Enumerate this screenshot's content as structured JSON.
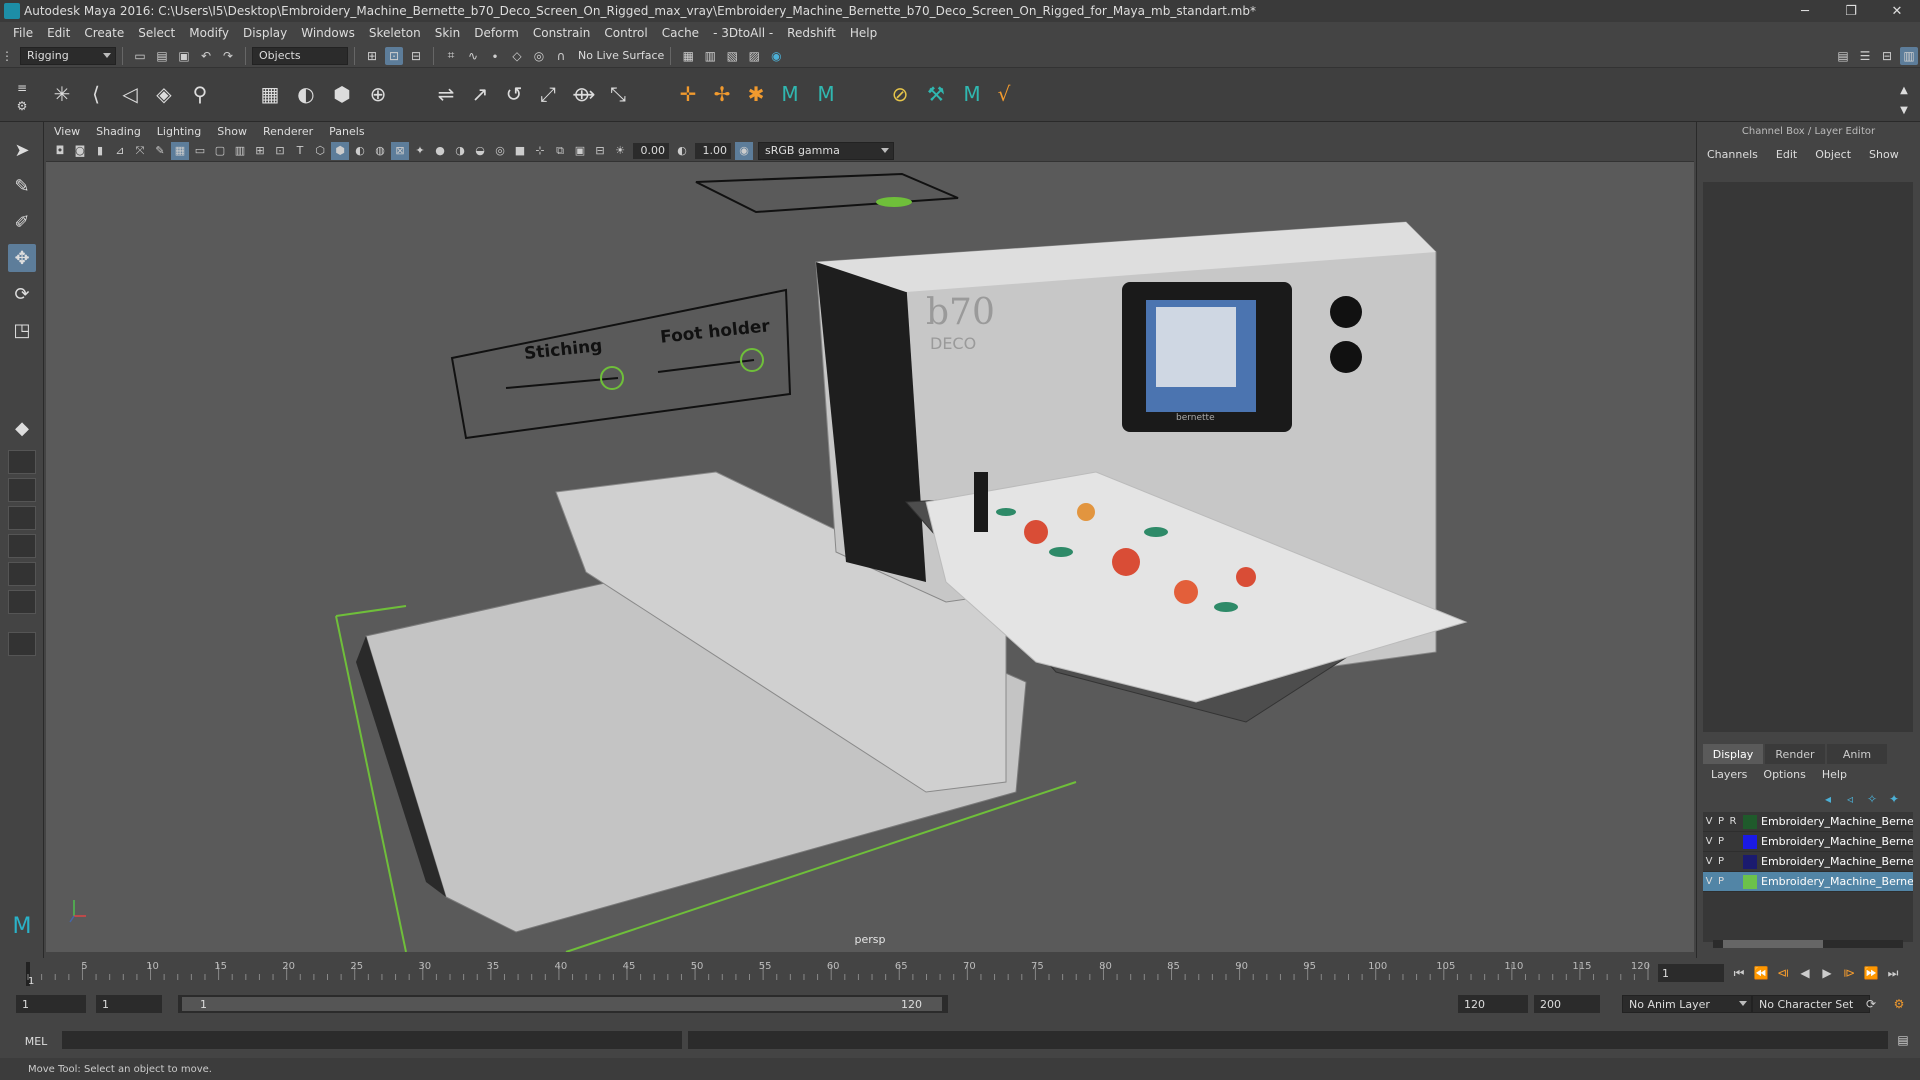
{
  "window": {
    "title": "Autodesk Maya 2016: C:\\Users\\I5\\Desktop\\Embroidery_Machine_Bernette_b70_Deco_Screen_On_Rigged_max_vray\\Embroidery_Machine_Bernette_b70_Deco_Screen_On_Rigged_for_Maya_mb_standart.mb*",
    "minimize": "─",
    "restore": "❐",
    "close": "✕"
  },
  "menubar": [
    "File",
    "Edit",
    "Create",
    "Select",
    "Modify",
    "Display",
    "Windows",
    "Skeleton",
    "Skin",
    "Deform",
    "Constrain",
    "Control",
    "Cache",
    "- 3DtoAll -",
    "Redshift",
    "Help"
  ],
  "statusline": {
    "mode": "Rigging",
    "selection_mask": "Objects",
    "live_surface": "No Live Surface"
  },
  "viewport": {
    "menu": [
      "View",
      "Shading",
      "Lighting",
      "Show",
      "Renderer",
      "Panels"
    ],
    "exposure": "0.00",
    "gamma": "1.00",
    "color_space": "sRGB gamma",
    "camera_label": "persp",
    "overlay_labels": {
      "stitching": "Stiching",
      "foot_holder": "Foot holder"
    },
    "machine_model": "b70",
    "machine_sub": "DECO",
    "machine_brand": "bernette"
  },
  "channel_box": {
    "title": "Channel Box / Layer Editor",
    "menu": [
      "Channels",
      "Edit",
      "Object",
      "Show"
    ],
    "layer_tabs": [
      "Display",
      "Render",
      "Anim"
    ],
    "layer_menu": [
      "Layers",
      "Options",
      "Help"
    ],
    "layers": [
      {
        "v": "V",
        "p": "P",
        "r": "R",
        "name": "Embroidery_Machine_Bernette",
        "color": "#1f5a2b",
        "selected": false
      },
      {
        "v": "V",
        "p": "P",
        "r": "",
        "name": "Embroidery_Machine_Bernette",
        "color": "#1a1ae6",
        "selected": false
      },
      {
        "v": "V",
        "p": "P",
        "r": "",
        "name": "Embroidery_Machine_Bernette",
        "color": "#1b1b6e",
        "selected": false
      },
      {
        "v": "V",
        "p": "P",
        "r": "",
        "name": "Embroidery_Machine_Bernette",
        "color": "#6cc24a",
        "selected": true
      }
    ]
  },
  "timeline": {
    "ticks": [
      "5",
      "10",
      "15",
      "20",
      "25",
      "30",
      "35",
      "40",
      "45",
      "50",
      "55",
      "60",
      "65",
      "70",
      "75",
      "80",
      "85",
      "90",
      "95",
      "100",
      "105",
      "110",
      "115",
      "120"
    ],
    "start_label": "1",
    "end_label": "120",
    "current_frame": "1"
  },
  "range": {
    "start": "1",
    "playback_start": "1",
    "slider_start": "1",
    "slider_end": "120",
    "playback_end": "120",
    "end": "200",
    "anim_layer": "No Anim Layer",
    "character_set": "No Character Set"
  },
  "command": {
    "language": "MEL"
  },
  "help": {
    "text": "Move Tool: Select an object to move."
  },
  "colors": {
    "accent": "#5d7d9a",
    "selection": "#5285a6",
    "grid_green": "#6fbf3a"
  }
}
